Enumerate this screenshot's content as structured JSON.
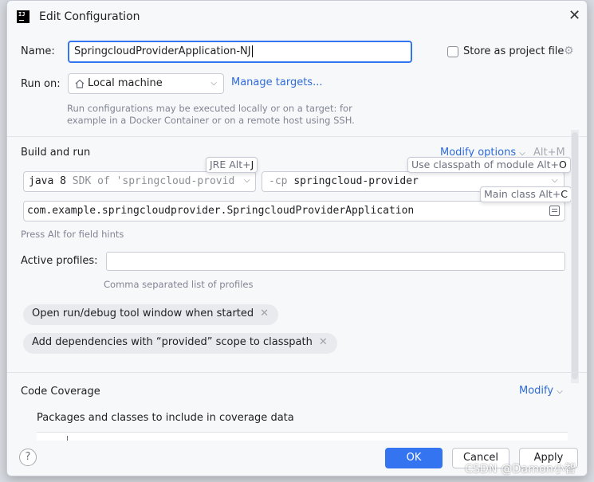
{
  "dialog": {
    "title": "Edit Configuration",
    "app_icon_text": "IJ"
  },
  "name_row": {
    "label": "Name:",
    "value": "SpringcloudProviderApplication-NJ",
    "store_label": "Store as project file"
  },
  "run_on": {
    "label": "Run on:",
    "selected": "Local machine",
    "manage_link": "Manage targets...",
    "hint": "Run configurations may be executed locally or on a target: for example in a Docker Container or on a remote host using SSH."
  },
  "build_and_run": {
    "title": "Build and run",
    "modify_options": "Modify options",
    "modify_shortcut": "Alt+M",
    "jre_tooltip": {
      "prefix": "JRE Alt+",
      "key": "J"
    },
    "cp_tooltip": {
      "prefix": "Use classpath of module Alt+",
      "key": "O"
    },
    "main_tooltip": {
      "prefix": "Main class Alt+",
      "key": "C"
    },
    "jre_value": "java 8",
    "jre_detail": " SDK of 'springcloud-provid",
    "cp_flag": "-cp ",
    "cp_value": "springcloud-provider",
    "main_class": "com.example.springcloudprovider.SpringcloudProviderApplication",
    "field_hint": "Press Alt for field hints"
  },
  "profiles": {
    "label": "Active profiles:",
    "value": "",
    "hint": "Comma separated list of profiles"
  },
  "options": [
    {
      "label": "Open run/debug tool window when started"
    },
    {
      "label": "Add dependencies with “provided” scope to classpath"
    }
  ],
  "coverage": {
    "title": "Code Coverage",
    "modify": "Modify",
    "packages_label": "Packages and classes to include in coverage data"
  },
  "footer": {
    "help": "?",
    "ok": "OK",
    "cancel": "Cancel",
    "apply": "Apply"
  },
  "watermark": "CSDN @Damon小智",
  "icons": {
    "close": "close-icon",
    "gear": "gear-icon",
    "home": "home-icon",
    "chevron": "chevron-down-icon",
    "browse": "browse-icon"
  },
  "colors": {
    "accent": "#3574f0",
    "link": "#2e6bd6",
    "hint": "#818594"
  }
}
